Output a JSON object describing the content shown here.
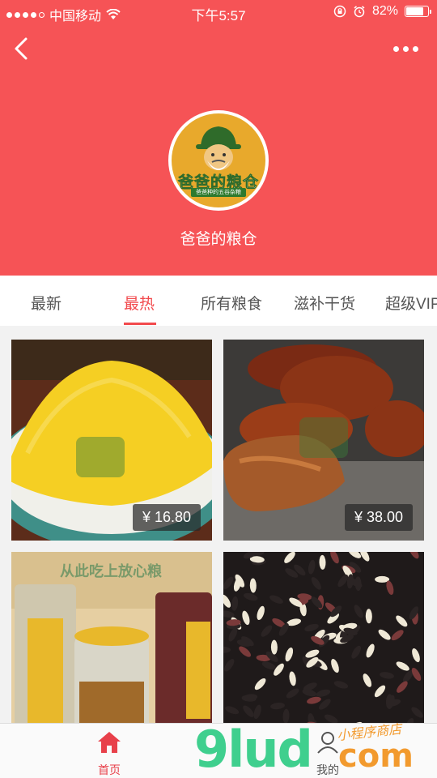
{
  "status_bar": {
    "carrier": "中国移动",
    "time": "下午5:57",
    "battery_percent": "82%",
    "battery_level": 0.82
  },
  "header": {
    "logo_title": "爸爸的粮仓",
    "logo_subtitle": "爸爸种的五谷杂粮",
    "shop_name": "爸爸的粮仓"
  },
  "tabs": [
    {
      "label": "最新",
      "active": false
    },
    {
      "label": "最热",
      "active": true
    },
    {
      "label": "所有粮食",
      "active": false
    },
    {
      "label": "滋补干货",
      "active": false
    },
    {
      "label": "超级VIP",
      "active": false
    }
  ],
  "products": [
    {
      "price": "¥ 16.80",
      "image": "yellow-millet"
    },
    {
      "price": "¥ 38.00",
      "image": "brown-sugar"
    },
    {
      "price": "",
      "image": "grain-jars",
      "overlay_text": "从此吃上放心粮"
    },
    {
      "price": "",
      "image": "black-rice"
    }
  ],
  "tabbar": {
    "home_label": "首页",
    "mine_label": "我的"
  },
  "watermark": {
    "main": "9lud",
    "com": "com",
    "script": "小程序商店"
  },
  "colors": {
    "header_bg": "#f65356",
    "accent": "#f24a4d",
    "logo_bg": "#e8a92c"
  }
}
